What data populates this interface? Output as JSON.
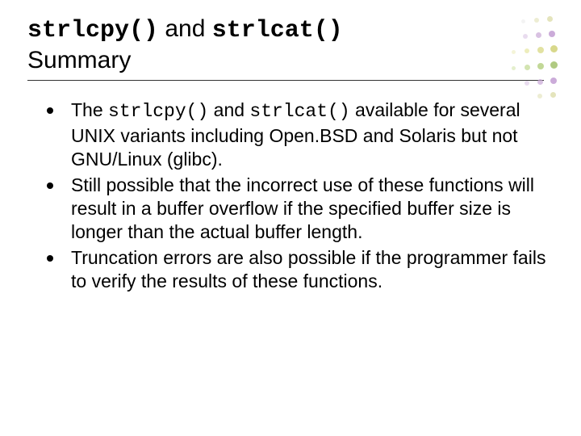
{
  "title": {
    "code1": "strlcpy()",
    "joiner": " and ",
    "code2": "strlcat()",
    "line2": "Summary"
  },
  "bullets": [
    {
      "pre": "The ",
      "code1": "strlcpy()",
      "mid": " and ",
      "code2": "strlcat()",
      "post": " available for several UNIX variants including Open.BSD and Solaris but not GNU/Linux (glibc)."
    },
    {
      "text": "Still possible that the incorrect use of these functions will result in a buffer overflow if the specified buffer size is longer than the actual buffer length."
    },
    {
      "text": "Truncation errors are also possible if the programmer fails to verify the results of these functions."
    }
  ]
}
